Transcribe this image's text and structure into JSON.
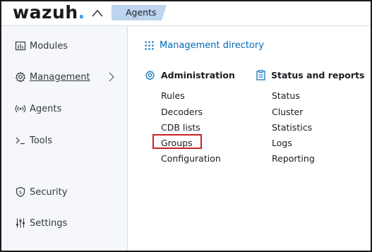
{
  "header": {
    "logo_text": "wazuh",
    "logo_dot": ".",
    "breadcrumb": "Agents"
  },
  "sidebar": {
    "items": [
      {
        "label": "Modules",
        "icon": "modules-icon"
      },
      {
        "label": "Management",
        "icon": "gear-icon",
        "active": true
      },
      {
        "label": "Agents",
        "icon": "signal-icon"
      },
      {
        "label": "Tools",
        "icon": "terminal-icon"
      },
      {
        "label": "Security",
        "icon": "shield-icon"
      },
      {
        "label": "Settings",
        "icon": "sliders-icon"
      }
    ]
  },
  "main": {
    "directory_link": "Management directory",
    "administration": {
      "title": "Administration",
      "links": [
        "Rules",
        "Decoders",
        "CDB lists",
        "Groups",
        "Configuration"
      ]
    },
    "status_reports": {
      "title": "Status and reports",
      "links": [
        "Status",
        "Cluster",
        "Statistics",
        "Logs",
        "Reporting"
      ]
    }
  },
  "colors": {
    "accent": "#006bb8",
    "logo_dot": "#3595f9",
    "breadcrumb_bg": "#bcd4ef",
    "highlight": "#cc2222"
  }
}
